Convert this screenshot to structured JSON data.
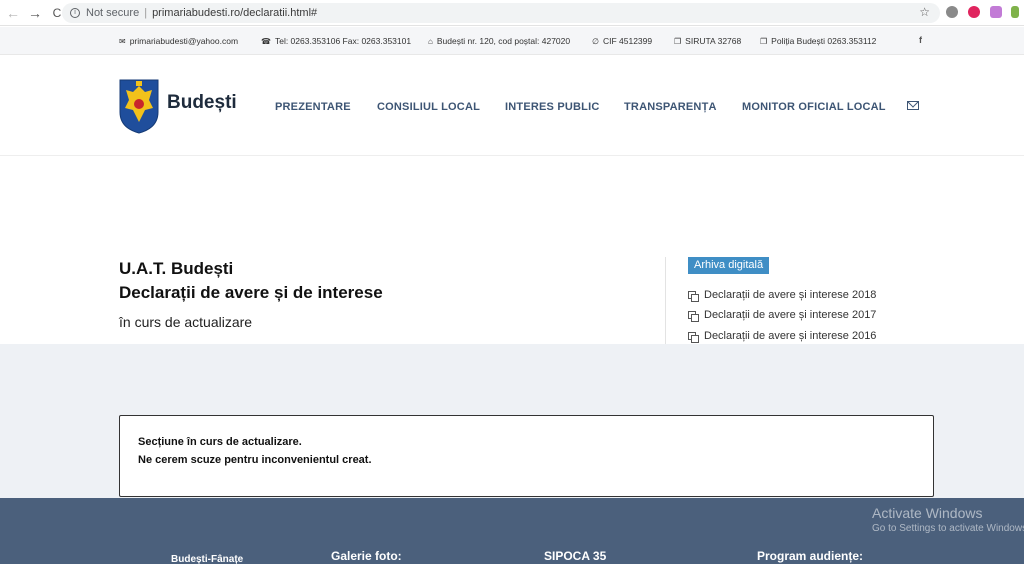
{
  "browser": {
    "back_icon": "←",
    "forward_icon": "→",
    "reload_icon": "C",
    "security": "Not secure",
    "url": "primariabudesti.ro/declaratii.html#"
  },
  "contact": {
    "email": "primariabudesti@yahoo.com",
    "phone": "Tel: 0263.353106 Fax: 0263.353101",
    "address": "Budești nr. 120, cod poștal: 427020",
    "cif": "CIF 4512399",
    "siruta": "SIRUTA 32768",
    "police": "Poliția Budești 0263.353112",
    "facebook": "f"
  },
  "header": {
    "logo_text": "Budești",
    "menu": [
      "PREZENTARE",
      "CONSILIUL LOCAL",
      "INTERES PUBLIC",
      "TRANSPARENȚA",
      "MONITOR OFICIAL LOCAL"
    ]
  },
  "content": {
    "title_line1": "U.A.T. Budești",
    "title_line2": "Declarații de avere și de interese",
    "subtitle": "în curs de actualizare",
    "archive_label": "Arhiva digitală",
    "archive_links": [
      "Declarații de avere și interese 2018",
      "Declarații de avere și interese 2017",
      "Declarații de avere și interese 2016"
    ]
  },
  "notice": {
    "line1": "Secțiune în curs de actualizare.",
    "line2": "Ne cerem scuze pentru inconvenientul creat."
  },
  "footer": {
    "col1": "Budești-Fânațe",
    "col2": "Galerie foto:",
    "col3": "SIPOCA 35",
    "col4": "Program audiențe:"
  },
  "watermark": {
    "title": "Activate Windows",
    "subtitle": "Go to Settings to activate Windows."
  },
  "colors": {
    "nav_text": "#3d5574",
    "accent_badge": "#3f8ec5",
    "footer_bg": "#4b607c",
    "band_bg": "#eef1f5"
  }
}
